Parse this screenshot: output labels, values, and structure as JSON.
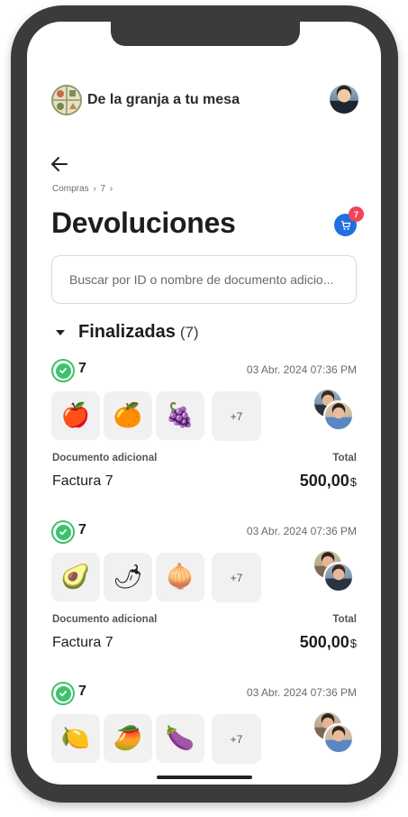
{
  "app": {
    "title": "De la granja a tu mesa",
    "logo_icon": "farm-logo-icon",
    "profile_icon": "user-avatar"
  },
  "nav": {
    "back_icon": "arrow-left-icon",
    "breadcrumb": [
      "Compras",
      "›",
      "7",
      "›"
    ]
  },
  "page": {
    "title": "Devoluciones",
    "cart_icon": "cart-icon",
    "cart_count": "7"
  },
  "search": {
    "placeholder": "Buscar por ID o nombre de documento adicio..."
  },
  "section": {
    "title": "Finalizadas",
    "count": "(7)",
    "toggle_icon": "caret-down-icon"
  },
  "cards": [
    {
      "id": "7",
      "date": "03 Abr. 2024 07:36 PM",
      "status_icon": "check-circle-icon",
      "items": [
        "🍎",
        "🍊",
        "🍇"
      ],
      "item_names": [
        "apple",
        "orange",
        "grapes"
      ],
      "more": "+7",
      "doc_label": "Documento adicional",
      "doc_value": "Factura 7",
      "total_label": "Total",
      "total_value": "500,00",
      "currency": "$"
    },
    {
      "id": "7",
      "date": "03 Abr. 2024 07:36 PM",
      "status_icon": "check-circle-icon",
      "items": [
        "🥑",
        "🌶",
        "🧅"
      ],
      "item_names": [
        "avocado",
        "chili-pepper",
        "onion"
      ],
      "more": "+7",
      "doc_label": "Documento adicional",
      "doc_value": "Factura 7",
      "total_label": "Total",
      "total_value": "500,00",
      "currency": "$"
    },
    {
      "id": "7",
      "date": "03 Abr. 2024 07:36 PM",
      "status_icon": "check-circle-icon",
      "items": [
        "🍋",
        "🥭",
        "🍆"
      ],
      "item_names": [
        "lime",
        "mango",
        "eggplant"
      ],
      "more": "+7"
    }
  ],
  "colors": {
    "accent": "#1f6fe0",
    "badge": "#f0445a",
    "success": "#3cc26b",
    "frame": "#3b3b3b"
  }
}
